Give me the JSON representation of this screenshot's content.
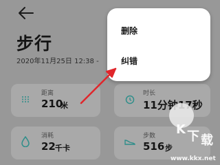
{
  "header": {
    "title": "步行",
    "date_time": "2020年11月25日 12:38 -"
  },
  "context_menu": {
    "items": [
      {
        "label": "删除"
      },
      {
        "label": "纠错"
      }
    ]
  },
  "stats": {
    "distance": {
      "label": "距离",
      "value": "210",
      "unit": "米",
      "icon": "route-icon"
    },
    "duration": {
      "label": "时长",
      "value": "11分钟17秒",
      "icon": "clock-icon"
    },
    "calories": {
      "label": "消耗",
      "value": "22",
      "unit": "千卡",
      "icon": "flame-icon"
    },
    "steps": {
      "label": "步数",
      "value": "516",
      "unit": "步",
      "icon": "shoe-icon"
    }
  },
  "annotation": {
    "arrow_color": "#e0262b"
  },
  "watermark": {
    "chars": [
      "K",
      "下",
      "载"
    ],
    "url": "www.kkx.net"
  },
  "colors": {
    "dim_overlay": "#989898",
    "menu_background": "#ffffff",
    "icon_green": "#2f8e8a"
  }
}
